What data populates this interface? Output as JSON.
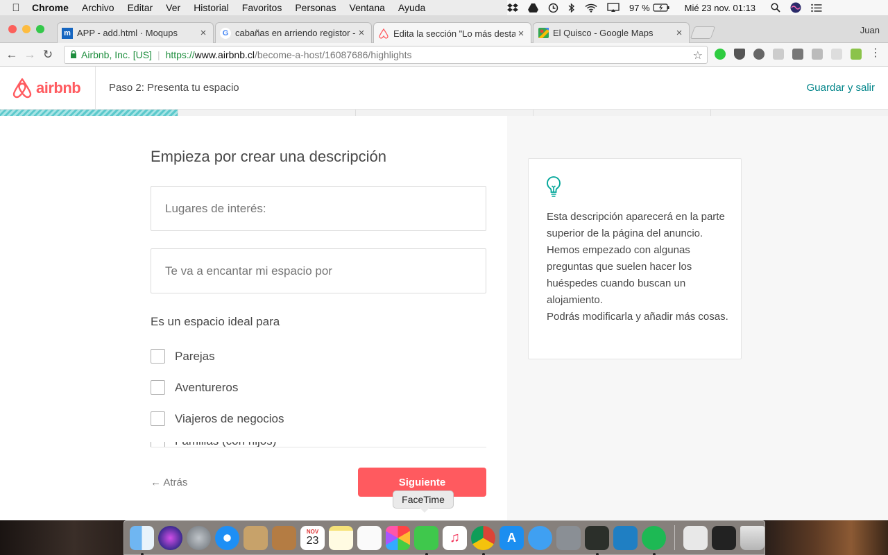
{
  "menubar": {
    "app_name": "Chrome",
    "items": [
      "Archivo",
      "Editar",
      "Ver",
      "Historial",
      "Favoritos",
      "Personas",
      "Ventana",
      "Ayuda"
    ],
    "battery": "97 %",
    "clock": "Mié 23 nov.  01:13"
  },
  "browser": {
    "tabs": [
      {
        "title": "APP - add.html · Moqups",
        "favicon": "moqups-icon",
        "fav_text": "m"
      },
      {
        "title": "cabañas en arriendo registor -",
        "favicon": "google-icon",
        "fav_text": "G"
      },
      {
        "title": "Edita la sección \"Lo más desta",
        "favicon": "airbnb-icon",
        "fav_text": ""
      },
      {
        "title": "El Quisco - Google Maps",
        "favicon": "maps-icon",
        "fav_text": ""
      }
    ],
    "profile_name": "Juan",
    "url": {
      "org": "Airbnb, Inc. [US]",
      "scheme": "https://",
      "host": "www.airbnb.cl",
      "path": "/become-a-host/16087686/highlights"
    }
  },
  "header": {
    "brand": "airbnb",
    "step_label": "Paso 2: Presenta tu espacio",
    "save_label": "Guardar y salir",
    "progress": 0.2
  },
  "form": {
    "title": "Empieza por crear una descripción",
    "field1_placeholder": "Lugares de interés:",
    "field2_placeholder": "Te va a encantar mi espacio por",
    "ideal_label": "Es un espacio ideal para",
    "options": [
      "Parejas",
      "Aventureros",
      "Viajeros de negocios",
      "Familias (con hijos)"
    ],
    "back_label": "← Atrás",
    "next_label": "Siguiente"
  },
  "tip": {
    "icon": "lightbulb-icon",
    "text": "Esta descripción aparecerá en la parte superior de la página del anuncio. Hemos empezado con algunas preguntas que suelen hacer los huéspedes cuando buscan un alojamiento.\nPodrás modificarla y añadir más cosas."
  },
  "dock": {
    "tooltip": "FaceTime",
    "calendar_month": "NOV",
    "calendar_day": "23"
  },
  "colors": {
    "brand": "#ff5a5f",
    "teal": "#008489",
    "text": "#484848"
  }
}
